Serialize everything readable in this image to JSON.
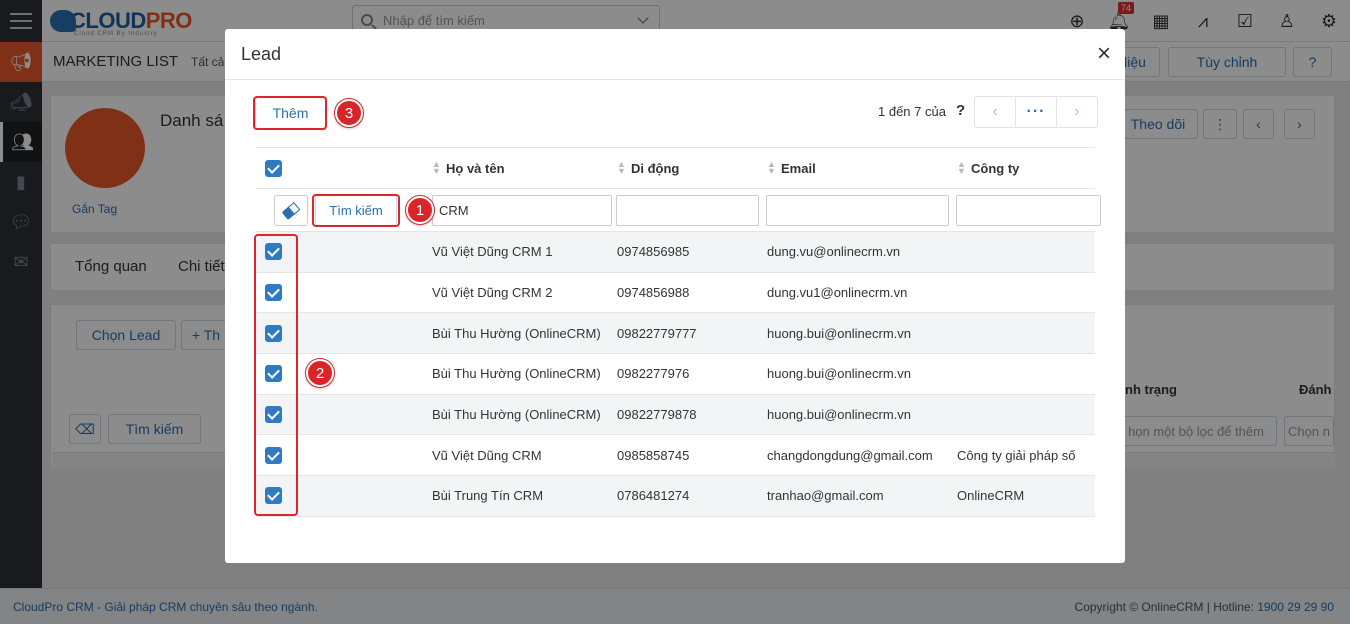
{
  "topbar": {
    "logo_main": "CLOUD",
    "logo_pro": "PRO",
    "logo_sub": "Cloud CRM By Industry",
    "search_placeholder": "Nhập để tìm kiếm",
    "notification_count": "74",
    "icons": [
      "plus-circle-icon",
      "bell-icon",
      "calendar-icon",
      "chart-icon",
      "checkbox-icon",
      "user-icon",
      "gear-icon"
    ]
  },
  "sidebar": {
    "icons": [
      "megaphone-icon",
      "campaign-icon",
      "users-group-icon",
      "book-icon",
      "chat-icon",
      "mail-icon"
    ]
  },
  "page": {
    "breadcrumb": "MARKETING LIST",
    "breadcrumb_sub": "Tất cả",
    "btn_data": "liệu",
    "btn_customize": "Tùy chỉnh",
    "record_title": "Danh sá",
    "tag_link": "Gắn Tag",
    "follow_btn": "Theo dõi",
    "tabs": [
      "Tổng quan",
      "Chi tiết"
    ],
    "select_lead_btn": "Chọn Lead",
    "add_btn": "+ Th",
    "search_btn": "Tìm kiếm",
    "col_status": "nh trạng",
    "col_rate": "Đánh",
    "filter_placeholder_1": "họn một bộ lọc để thêm",
    "filter_placeholder_2": "Chọn n"
  },
  "modal": {
    "title": "Lead",
    "close": "×",
    "add_button": "Thêm",
    "pager_info": "1 đến 7 của",
    "pager_help": "?",
    "pager_more": "···",
    "search_button": "Tìm kiếm",
    "callouts": [
      "1",
      "2",
      "3"
    ],
    "columns": {
      "name": "Họ và tên",
      "phone": "Di động",
      "email": "Email",
      "company": "Công ty"
    },
    "filters": {
      "name": "CRM",
      "phone": "",
      "email": "",
      "company": ""
    },
    "rows": [
      {
        "name": "Vũ Việt Dũng CRM 1",
        "phone": "0974856985",
        "email": "dung.vu@onlinecrm.vn",
        "company": "",
        "checked": true
      },
      {
        "name": "Vũ Việt Dũng CRM 2",
        "phone": "0974856988",
        "email": "dung.vu1@onlinecrm.vn",
        "company": "",
        "checked": true
      },
      {
        "name": "Bùi Thu Hường (OnlineCRM)",
        "phone": "09822779777",
        "email": "huong.bui@onlinecrm.vn",
        "company": "",
        "checked": true
      },
      {
        "name": "Bùi Thu Hường (OnlineCRM)",
        "phone": "0982277976",
        "email": "huong.bui@onlinecrm.vn",
        "company": "",
        "checked": true
      },
      {
        "name": "Bùi Thu Hường (OnlineCRM)",
        "phone": "09822779878",
        "email": "huong.bui@onlinecrm.vn",
        "company": "",
        "checked": true
      },
      {
        "name": "Vũ Việt Dũng CRM",
        "phone": "0985858745",
        "email": "changdongdung@gmail.com",
        "company": "Công ty giải pháp số",
        "checked": true
      },
      {
        "name": "Bùi Trung Tín CRM",
        "phone": "0786481274",
        "email": "tranhao@gmail.com",
        "company": "OnlineCRM",
        "checked": true
      }
    ]
  },
  "footer": {
    "left": "CloudPro CRM - Giải pháp CRM chuyên sâu theo ngành.",
    "right_prefix": "Copyright © OnlineCRM | Hotline:",
    "hotline": "1900 29 29 90"
  }
}
